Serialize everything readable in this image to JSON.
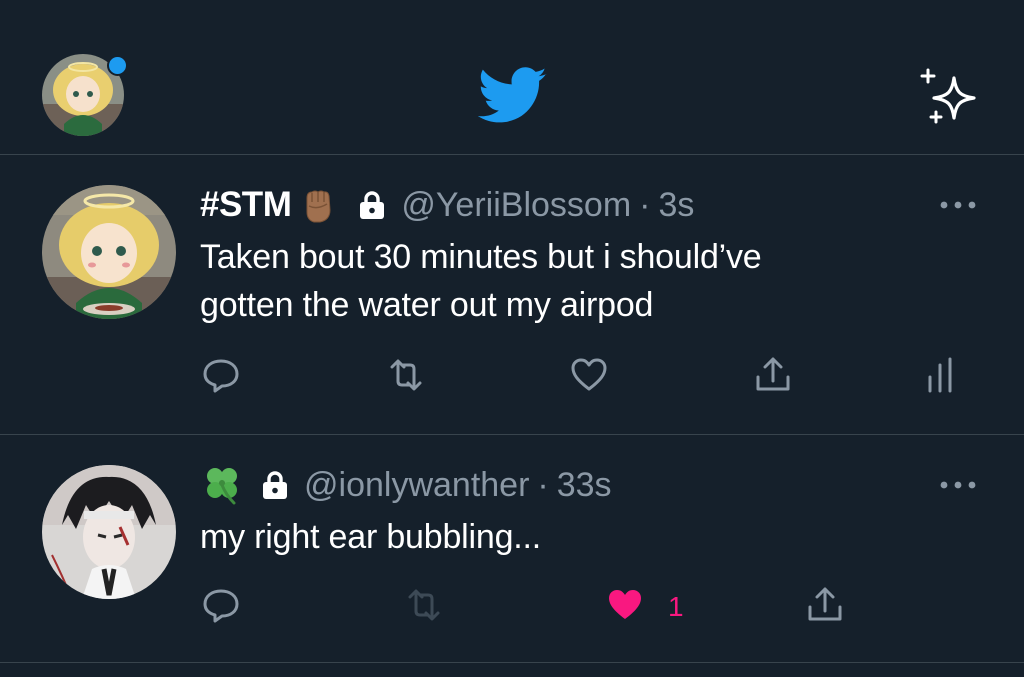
{
  "topbar": {
    "avatar_icon": "profile-avatar",
    "logo_icon": "twitter-bird-icon",
    "sparkle_icon": "sparkle-icon",
    "accent": "#1d9bf0"
  },
  "tweets": [
    {
      "display_name": "#STM",
      "emoji": "raised-fist-emoji",
      "protected": true,
      "handle": "@YeriiBlossom",
      "separator": "·",
      "time": "3s",
      "text_line1": "Taken bout 30 minutes but i should’ve",
      "text_line2": "gotten the water out my airpod",
      "actions": [
        "reply-icon",
        "retweet-icon",
        "like-icon",
        "share-icon",
        "analytics-icon"
      ]
    },
    {
      "display_name": "",
      "emoji": "four-leaf-clover-emoji",
      "protected": true,
      "handle": "@ionlywanther",
      "separator": "·",
      "time": "33s",
      "text_line1": "my right ear bubbling...",
      "like_count": "1",
      "liked": true,
      "actions": [
        "reply-icon",
        "retweet-icon",
        "like-icon",
        "share-icon"
      ]
    }
  ],
  "colors": {
    "background": "#15202b",
    "divider": "#38444d",
    "muted": "#8b98a5",
    "like": "#f91880"
  }
}
